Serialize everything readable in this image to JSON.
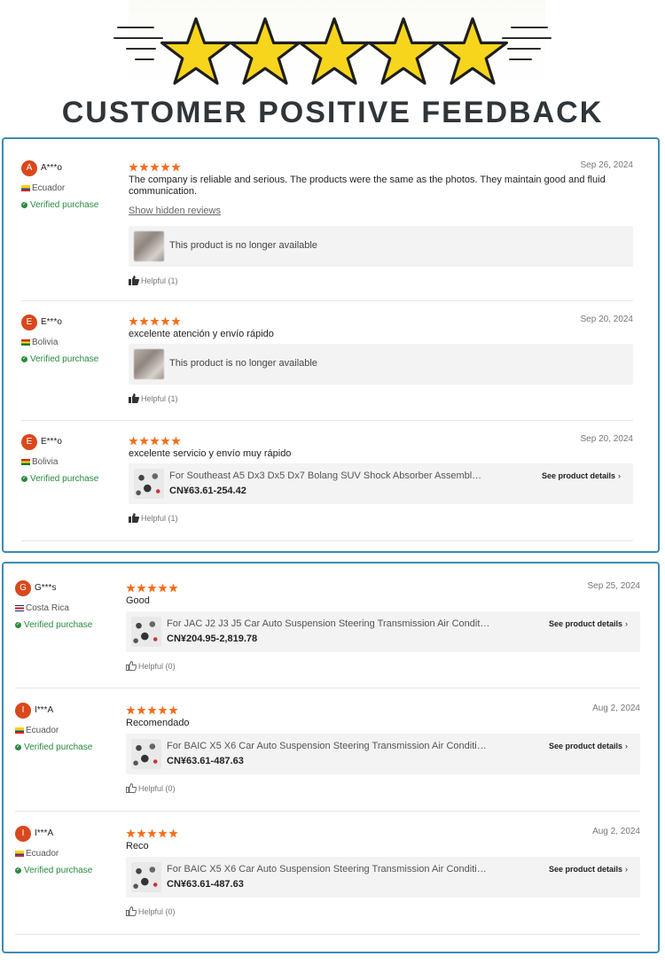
{
  "header": {
    "title": "CUSTOMER POSITIVE FEEDBACK",
    "star_count": 5,
    "star_color": "#f7d51d"
  },
  "colors": {
    "border": "#3c8bb5",
    "star": "#f36d1c",
    "avatar": "#d9481c",
    "verified": "#2a8a3e"
  },
  "panel1": {
    "reviews": [
      {
        "avatar_letter": "A",
        "username": "A***o",
        "country": "Ecuador",
        "flag": "flag-ecuador",
        "verified": "Verified purchase",
        "rating": 5,
        "date": "Sep 26, 2024",
        "text": "The company is reliable and serious. The products were the same as the photos. They maintain good and fluid communication.",
        "show_hidden": "Show hidden reviews",
        "product_unavailable": "This product is no longer available",
        "helpful": "Helpful (1)"
      },
      {
        "avatar_letter": "E",
        "username": "E***o",
        "country": "Bolivia",
        "flag": "flag-bolivia",
        "verified": "Verified purchase",
        "rating": 5,
        "date": "Sep 20, 2024",
        "text": "excelente atención y envío rápido",
        "product_unavailable": "This product is no longer available",
        "helpful": "Helpful (1)"
      },
      {
        "avatar_letter": "E",
        "username": "E***o",
        "country": "Bolivia",
        "flag": "flag-bolivia",
        "verified": "Verified purchase",
        "rating": 5,
        "date": "Sep 20, 2024",
        "text": "excelente servicio y envío muy rápido",
        "product_title": "For Southeast A5 Dx3 Dx5 Dx7 Bolang SUV Shock Absorber Assembly Front R...",
        "product_price": "CN¥63.61-254.42",
        "product_details": "See product details",
        "helpful": "Helpful (1)"
      }
    ]
  },
  "panel2": {
    "reviews": [
      {
        "avatar_letter": "G",
        "username": "G***s",
        "country": "Costa Rica",
        "flag": "flag-costa-rica",
        "verified": "Verified purchase",
        "rating": 5,
        "date": "Sep 25, 2024",
        "text": "Good",
        "product_title": "For JAC J2 J3 J5 Car Auto Suspension Steering Transmission Air Conditioning ...",
        "product_price": "CN¥204.95-2,819.78",
        "product_details": "See product details",
        "helpful": "Helpful (0)"
      },
      {
        "avatar_letter": "I",
        "username": "I***A",
        "country": "Ecuador",
        "flag": "flag-ecuador",
        "verified": "Verified purchase",
        "rating": 5,
        "date": "Aug 2, 2024",
        "text": "Recomendado",
        "product_title": "For BAIC X5 X6 Car Auto Suspension Steering Transmission Air Conditioning Li...",
        "product_price": "CN¥63.61-487.63",
        "product_details": "See product details",
        "helpful": "Helpful (0)"
      },
      {
        "avatar_letter": "I",
        "username": "I***A",
        "country": "Ecuador",
        "flag": "flag-ecuador",
        "verified": "Verified purchase",
        "rating": 5,
        "date": "Aug 2, 2024",
        "text": "Reco",
        "product_title": "For BAIC X5 X6 Car Auto Suspension Steering Transmission Air Conditioning Li...",
        "product_price": "CN¥63.61-487.63",
        "product_details": "See product details",
        "helpful": "Helpful (0)"
      }
    ]
  }
}
